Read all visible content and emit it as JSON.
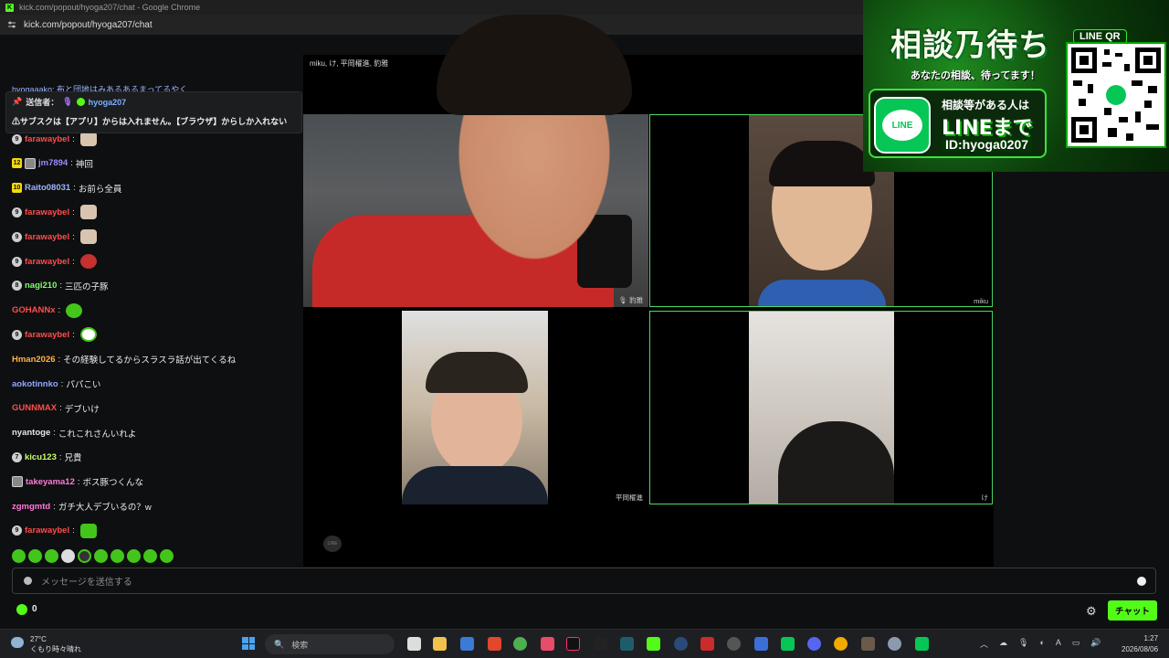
{
  "browser": {
    "window_title": "kick.com/popout/hyoga207/chat - Google Chrome",
    "url": "kick.com/popout/hyoga207/chat"
  },
  "pinned": {
    "label": "送信者：",
    "user": "hyoga207",
    "text": "⚠サブスクは【アプリ】からは入れません。【ブラウザ】からしか入れない"
  },
  "chat": {
    "partial_top": "hyogaaako: 布と団地はみあるあるまってるやく",
    "messages": [
      {
        "badge": "9",
        "badge_type": "circle",
        "user": "farawaybel",
        "user_color": "#ff4d4d",
        "text": "",
        "emote": "cat"
      },
      {
        "badge": "12",
        "badge_type": "square",
        "user": "jm7894",
        "user_color": "#9b8cff",
        "text": "神回",
        "emote": ""
      },
      {
        "badge": "10",
        "badge_type": "square",
        "user": "Raito08031",
        "user_color": "#9bb7ff",
        "text": "お前ら全員",
        "emote": ""
      },
      {
        "badge": "9",
        "badge_type": "circle",
        "user": "farawaybel",
        "user_color": "#ff4d4d",
        "text": "",
        "emote": "cat"
      },
      {
        "badge": "9",
        "badge_type": "circle",
        "user": "farawaybel",
        "user_color": "#ff4d4d",
        "text": "",
        "emote": "cat"
      },
      {
        "badge": "9",
        "badge_type": "circle",
        "user": "farawaybel",
        "user_color": "#ff4d4d",
        "text": "",
        "emote": "red"
      },
      {
        "badge": "8",
        "badge_type": "circle",
        "user": "nagi210",
        "user_color": "#7dff6b",
        "text": "三匹の子豚",
        "emote": ""
      },
      {
        "badge": "",
        "badge_type": "",
        "user": "GOHANNx",
        "user_color": "#ff4d4d",
        "text": "",
        "emote": "green"
      },
      {
        "badge": "9",
        "badge_type": "circle",
        "user": "farawaybel",
        "user_color": "#ff4d4d",
        "text": "",
        "emote": "ball"
      },
      {
        "badge": "",
        "badge_type": "",
        "user": "Hman2026",
        "user_color": "#ffb347",
        "text": "その経験してるからスラスラ話が出てくるね",
        "emote": ""
      },
      {
        "badge": "",
        "badge_type": "",
        "user": "aokotinnko",
        "user_color": "#8fa8ff",
        "text": "パパこい",
        "emote": ""
      },
      {
        "badge": "",
        "badge_type": "",
        "user": "GUNNMAX",
        "user_color": "#ff4d4d",
        "text": "デブいけ",
        "emote": ""
      },
      {
        "badge": "",
        "badge_type": "",
        "user": "nyantoge",
        "user_color": "#e6e6e6",
        "text": "これこれさんいれよ",
        "emote": ""
      },
      {
        "badge": "7",
        "badge_type": "circle",
        "user": "kicu123",
        "user_color": "#c7ff6b",
        "text": "兄貴",
        "emote": ""
      },
      {
        "badge": "",
        "badge_type": "avatar",
        "user": "takeyama12",
        "user_color": "#ff7ad9",
        "text": "ボス豚つくんな",
        "emote": ""
      },
      {
        "badge": "",
        "badge_type": "",
        "user": "zgmgmtd",
        "user_color": "#ff7ad9",
        "text": "ガチ大人デブいるの？w",
        "emote": ""
      },
      {
        "badge": "9",
        "badge_type": "circle",
        "user": "farawaybel",
        "user_color": "#ff4d4d",
        "text": "",
        "emote": "greenbox"
      }
    ]
  },
  "stream": {
    "call_participants": "miku, け, 平岡櫂進, 豹雅",
    "tiles": [
      {
        "label": "🎙 豹雅"
      },
      {
        "label": "miku"
      },
      {
        "label": "平岡櫂進"
      },
      {
        "label": "け"
      }
    ],
    "watermark": "LINE"
  },
  "promo": {
    "title": "相談乃待ち",
    "subtitle": "あなたの相談、待ってます！",
    "line_logo": "LINE",
    "line1": "相談等がある人は",
    "line2": "LINEまで",
    "line3": "ID:hyoga0207",
    "qr_label": "LINE QR"
  },
  "input": {
    "placeholder": "メッセージを送信する",
    "points": "0",
    "chat_button": "チャット"
  },
  "taskbar": {
    "weather_temp": "27°C",
    "weather_desc": "くもり時々晴れ",
    "search_placeholder": "検索",
    "time": "1:27",
    "date": "2026/08/06"
  },
  "colors": {
    "kick_green": "#53fc18",
    "tile_highlight": "#4cd964",
    "line_green": "#06c755"
  }
}
